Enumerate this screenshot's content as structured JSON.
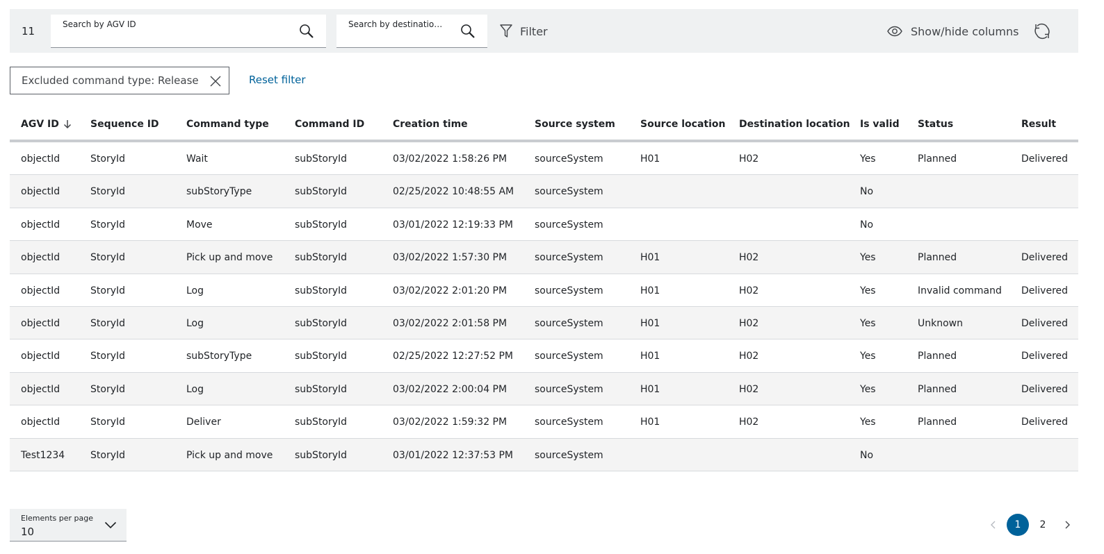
{
  "toolbar": {
    "result_count": "11",
    "search_agv_placeholder": "Search by AGV ID",
    "search_destination_placeholder": "Search by destination...",
    "filter_label": "Filter",
    "show_hide_label": "Show/hide columns"
  },
  "filters": {
    "chip_label": "Excluded command type: Release",
    "reset_label": "Reset filter"
  },
  "table": {
    "headers": [
      "AGV ID",
      "Sequence ID",
      "Command type",
      "Command ID",
      "Creation time",
      "Source system",
      "Source location",
      "Destination location",
      "Is valid",
      "Status",
      "Result"
    ],
    "sort_column": "AGV ID",
    "rows": [
      [
        "objectId",
        "StoryId",
        "Wait",
        "subStoryId",
        "03/02/2022 1:58:26 PM",
        "sourceSystem",
        "H01",
        "H02",
        "Yes",
        "Planned",
        "Delivered"
      ],
      [
        "objectId",
        "StoryId",
        "subStoryType",
        "subStoryId",
        "02/25/2022 10:48:55 AM",
        "sourceSystem",
        "",
        "",
        "No",
        "",
        ""
      ],
      [
        "objectId",
        "StoryId",
        "Move",
        "subStoryId",
        "03/01/2022 12:19:33 PM",
        "sourceSystem",
        "",
        "",
        "No",
        "",
        ""
      ],
      [
        "objectId",
        "StoryId",
        "Pick up and move",
        "subStoryId",
        "03/02/2022 1:57:30 PM",
        "sourceSystem",
        "H01",
        "H02",
        "Yes",
        "Planned",
        "Delivered"
      ],
      [
        "objectId",
        "StoryId",
        "Log",
        "subStoryId",
        "03/02/2022 2:01:20 PM",
        "sourceSystem",
        "H01",
        "H02",
        "Yes",
        "Invalid command",
        "Delivered"
      ],
      [
        "objectId",
        "StoryId",
        "Log",
        "subStoryId",
        "03/02/2022 2:01:58 PM",
        "sourceSystem",
        "H01",
        "H02",
        "Yes",
        "Unknown",
        "Delivered"
      ],
      [
        "objectId",
        "StoryId",
        "subStoryType",
        "subStoryId",
        "02/25/2022 12:27:52 PM",
        "sourceSystem",
        "H01",
        "H02",
        "Yes",
        "Planned",
        "Delivered"
      ],
      [
        "objectId",
        "StoryId",
        "Log",
        "subStoryId",
        "03/02/2022 2:00:04 PM",
        "sourceSystem",
        "H01",
        "H02",
        "Yes",
        "Planned",
        "Delivered"
      ],
      [
        "objectId",
        "StoryId",
        "Deliver",
        "subStoryId",
        "03/02/2022 1:59:32 PM",
        "sourceSystem",
        "H01",
        "H02",
        "Yes",
        "Planned",
        "Delivered"
      ],
      [
        "Test1234",
        "StoryId",
        "Pick up and move",
        "subStoryId",
        "03/01/2022 12:37:53 PM",
        "sourceSystem",
        "",
        "",
        "No",
        "",
        ""
      ]
    ]
  },
  "footer": {
    "per_page_label": "Elements per page",
    "per_page_value": "10",
    "pages": [
      "1",
      "2"
    ],
    "current_page": "1"
  },
  "icons": {
    "search": "search-icon",
    "filter": "filter-icon",
    "eye": "eye-icon",
    "refresh": "refresh-icon",
    "close": "close-icon",
    "sort_down": "arrow-down-icon",
    "chevron_down": "chevron-down-icon",
    "prev": "chevron-left-icon",
    "next": "chevron-right-icon"
  },
  "colors": {
    "accent": "#00629a",
    "toolbar_bg": "#eff1f2",
    "row_alt_bg": "#f4f4f4"
  }
}
